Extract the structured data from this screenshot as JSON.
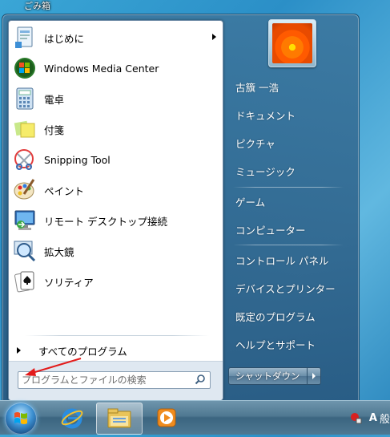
{
  "desktop": {
    "recycle_bin_label": "ごみ箱"
  },
  "start_menu": {
    "programs": [
      {
        "label": "はじめに",
        "icon": "getting-started-icon",
        "has_submenu": true
      },
      {
        "label": "Windows Media Center",
        "icon": "media-center-icon",
        "has_submenu": false
      },
      {
        "label": "電卓",
        "icon": "calculator-icon",
        "has_submenu": false
      },
      {
        "label": "付箋",
        "icon": "sticky-notes-icon",
        "has_submenu": false
      },
      {
        "label": "Snipping Tool",
        "icon": "snipping-tool-icon",
        "has_submenu": false
      },
      {
        "label": "ペイント",
        "icon": "paint-icon",
        "has_submenu": false
      },
      {
        "label": "リモート デスクトップ接続",
        "icon": "remote-desktop-icon",
        "has_submenu": false
      },
      {
        "label": "拡大鏡",
        "icon": "magnifier-icon",
        "has_submenu": false
      },
      {
        "label": "ソリティア",
        "icon": "solitaire-icon",
        "has_submenu": false
      }
    ],
    "all_programs_label": "すべてのプログラム",
    "search": {
      "placeholder": "プログラムとファイルの検索",
      "value": ""
    },
    "right_items": [
      {
        "label": "古籏 一浩",
        "key": "user"
      },
      {
        "label": "ドキュメント",
        "key": "documents"
      },
      {
        "label": "ピクチャ",
        "key": "pictures"
      },
      {
        "label": "ミュージック",
        "key": "music"
      },
      {
        "label": "ゲーム",
        "key": "games"
      },
      {
        "label": "コンピューター",
        "key": "computer"
      },
      {
        "label": "コントロール パネル",
        "key": "control-panel"
      },
      {
        "label": "デバイスとプリンター",
        "key": "devices-printers"
      },
      {
        "label": "既定のプログラム",
        "key": "default-programs"
      },
      {
        "label": "ヘルプとサポート",
        "key": "help-support"
      }
    ],
    "shutdown_label": "シャットダウン"
  },
  "taskbar": {
    "pinned": [
      {
        "name": "internet-explorer-icon",
        "active": false
      },
      {
        "name": "explorer-folder-icon",
        "active": true
      },
      {
        "name": "media-player-icon",
        "active": false
      }
    ],
    "tray": {
      "ime_mode": "A",
      "ime_label": "般"
    }
  },
  "colors": {
    "annotation_arrow": "#e31b1b",
    "taskbar": "#4f7891",
    "menu_right_pane": "#3d6f93"
  }
}
